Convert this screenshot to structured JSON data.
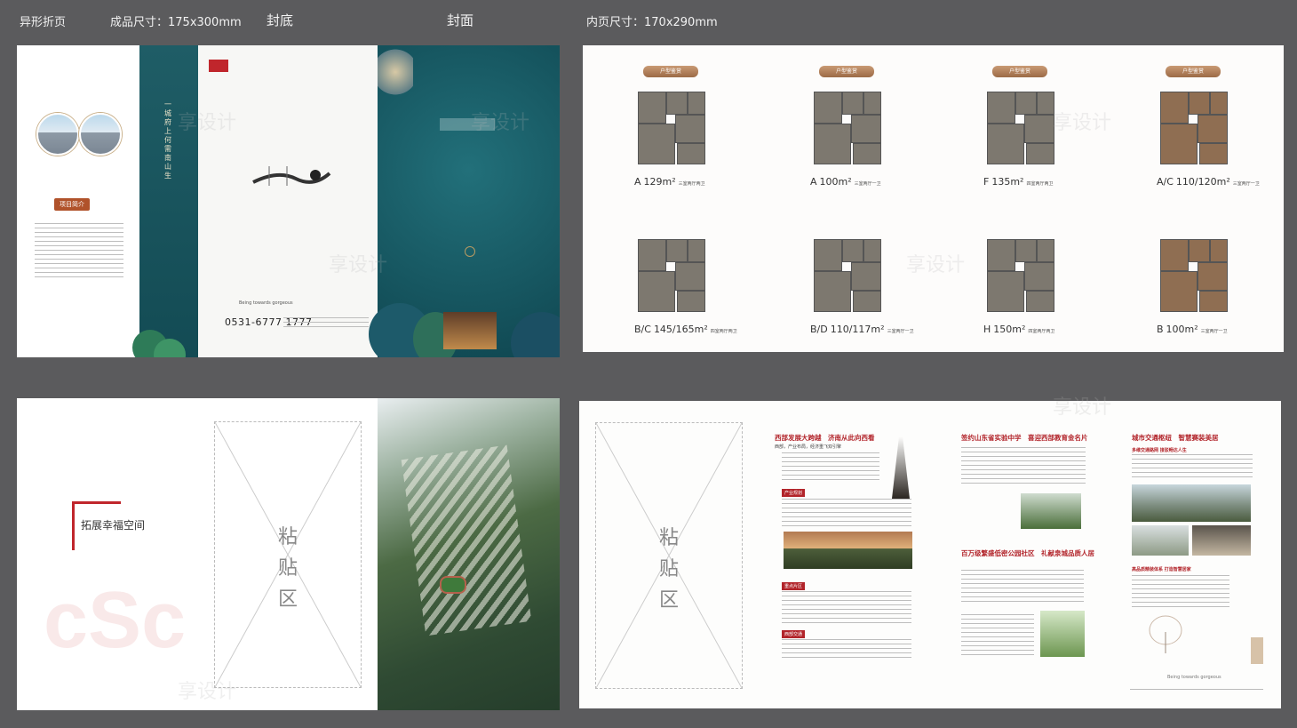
{
  "headers": {
    "irregular_fold": "异形折页",
    "finished_size": "成品尺寸：175x300mm",
    "back_cover": "封底",
    "front_cover": "封面",
    "inner_size": "内页尺寸：170x290mm"
  },
  "panel1": {
    "project_intro_label": "项目简介",
    "vertical_slogan": "一城府上　何需南山生",
    "phone": "0531-6777 1777",
    "cover_slogan": "Being towards gorgeous"
  },
  "panel2": {
    "floorplans": [
      {
        "tag": "户型鉴赏",
        "code": "A",
        "area": "129m²",
        "rooms": "三室两厅两卫"
      },
      {
        "tag": "户型鉴赏",
        "code": "A",
        "area": "100m²",
        "rooms": "三室两厅一卫"
      },
      {
        "tag": "户型鉴赏",
        "code": "F",
        "area": "135m²",
        "rooms": "四室两厅两卫"
      },
      {
        "tag": "户型鉴赏",
        "code": "A/C",
        "area": "110/120m²",
        "rooms": "三室两厅一卫"
      },
      {
        "tag": "",
        "code": "B/C",
        "area": "145/165m²",
        "rooms": "四室两厅两卫"
      },
      {
        "tag": "",
        "code": "B/D",
        "area": "110/117m²",
        "rooms": "三室两厅一卫"
      },
      {
        "tag": "",
        "code": "H",
        "area": "150m²",
        "rooms": "四室两厅两卫"
      },
      {
        "tag": "",
        "code": "B",
        "area": "100m²",
        "rooms": "三室两厅一卫"
      }
    ]
  },
  "panel3": {
    "brand_line": "拓展幸福空间",
    "paste_area": [
      "粘",
      "贴",
      "区"
    ]
  },
  "panel4": {
    "paste_area": [
      "粘",
      "贴",
      "区"
    ],
    "col1_heading": "西部发展大跨越　济南从此向西看",
    "col1_sub": "西部，产业布局，经济重飞双引擎",
    "col1_tags": [
      "产业规划",
      "重点片区",
      "西部交通"
    ],
    "col2_heading": "签约山东省实验中学　喜迎西部教育金名片",
    "col2_heading2": "百万级繁盛低密公园社区　礼献泉城品质人居",
    "col3_heading": "城市交通枢纽　智慧赛装美居",
    "col3_sub1": "多维交通路网 接驳畅达人生",
    "col3_sub2": "高品质精装体系 打造智慧居家",
    "footer": "Being towards gorgeous"
  },
  "watermark": "享设计"
}
